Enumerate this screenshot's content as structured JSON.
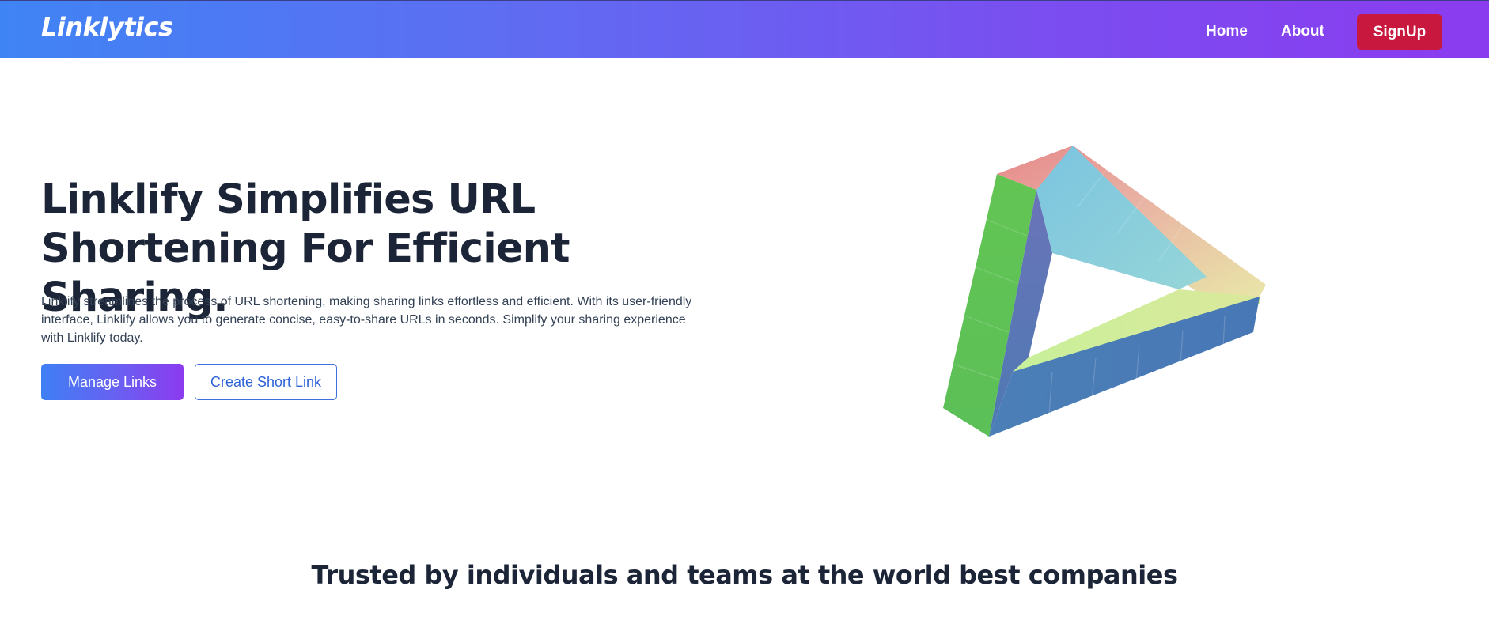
{
  "navbar": {
    "brand": "Linklytics",
    "links": [
      {
        "label": "Home"
      },
      {
        "label": "About"
      }
    ],
    "signup_label": "SignUp",
    "colors": {
      "gradient_start": "#3f84f5",
      "gradient_end": "#8b3bef",
      "signup_bg": "#c8183d"
    }
  },
  "hero": {
    "title": "Linklify Simplifies URL Shortening For Efficient Sharing.",
    "description": "Linklify streamlines the process of URL shortening, making sharing links effortless and efficient. With its user-friendly interface, Linklify allows you to generate concise, easy-to-share URLs in seconds. Simplify your sharing experience with Linklify today.",
    "primary_button": "Manage Links",
    "secondary_button": "Create Short Link",
    "illustration": "impossible-triangle-icon"
  },
  "trusted": {
    "title": "Trusted by individuals and teams at the world best companies"
  }
}
